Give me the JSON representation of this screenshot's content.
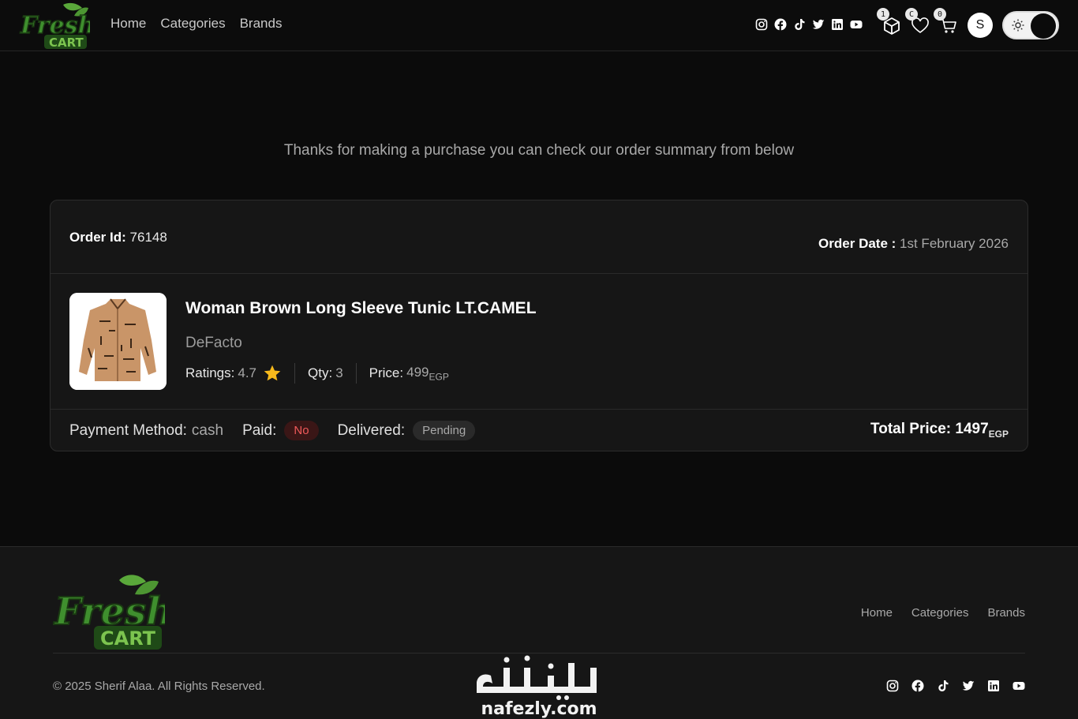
{
  "nav": {
    "links": [
      "Home",
      "Categories",
      "Brands"
    ],
    "social_icons": [
      "instagram-icon",
      "facebook-icon",
      "tiktok-icon",
      "twitter-icon",
      "linkedin-icon",
      "youtube-icon"
    ],
    "orders_badge": "1",
    "wishlist_badge": "C",
    "cart_badge": "0",
    "avatar_letter": "S"
  },
  "main": {
    "thanks_text": "Thanks for making a purchase you can check our order summary from below"
  },
  "order": {
    "id_label": "Order Id:",
    "id_value": "76148",
    "date_label": "Order Date :",
    "date_value": "1st February 2026",
    "item": {
      "title": "Woman Brown Long Sleeve Tunic LT.CAMEL",
      "brand": "DeFacto",
      "ratings_label": "Ratings:",
      "ratings_value": "4.7",
      "qty_label": "Qty:",
      "qty_value": "3",
      "price_label": "Price:",
      "price_value": "499",
      "price_currency": "EGP"
    },
    "payment_label": "Payment Method:",
    "payment_value": "cash",
    "paid_label": "Paid:",
    "paid_value": "No",
    "delivered_label": "Delivered:",
    "delivered_value": "Pending",
    "total_label": "Total Price:",
    "total_value": "1497",
    "total_currency": "EGP"
  },
  "footer": {
    "links": [
      "Home",
      "Categories",
      "Brands"
    ],
    "copyright": "© 2025 Sherif Alaa. All Rights Reserved.",
    "watermark_text": "nafezly.com"
  },
  "colors": {
    "background": "#0b0b0b",
    "card": "#161616",
    "brand_green": "#3f8f2e",
    "danger": "#f05a5a",
    "star": "#f6b91c"
  }
}
